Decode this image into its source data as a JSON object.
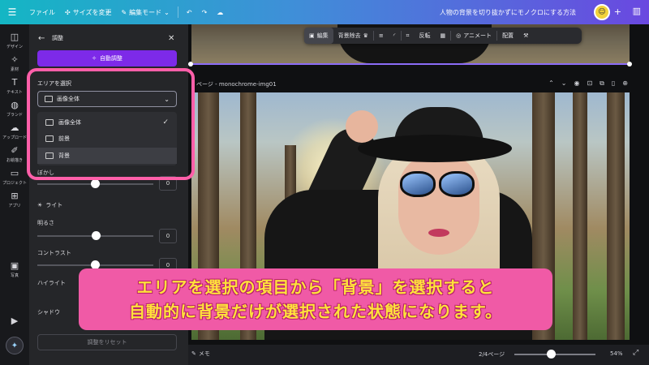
{
  "topbar": {
    "file": "ファイル",
    "resize": "サイズを変更",
    "edit_mode": "編集モード",
    "title": "人物の背景を切り抜かずにモノクロにする方法"
  },
  "rail": {
    "design": "デザイン",
    "elements": "素材",
    "text": "テキスト",
    "brand": "ブランド",
    "uploads": "アップロード",
    "drawing": "お絵描き",
    "projects": "プロジェクト",
    "apps": "アプリ",
    "photos": "写真"
  },
  "panel": {
    "title": "調整",
    "auto_adjust": "自動調整",
    "area_label": "エリアを選択",
    "area_selected": "画像全体",
    "options": [
      {
        "label": "画像全体"
      },
      {
        "label": "前景"
      },
      {
        "label": "背景"
      }
    ],
    "partial_label": "ぼかし",
    "light_header": "ライト",
    "brightness_label": "明るさ",
    "brightness_value": "0",
    "contrast_label": "コントラスト",
    "contrast_value": "0",
    "highlight_label": "ハイライト",
    "shadow_label": "シャドウ",
    "blur_value": "0",
    "reset": "調整をリセット"
  },
  "toolbar": {
    "edit": "編集",
    "bg_remove": "背景除去",
    "flip": "反転",
    "animate": "アニメート",
    "arrange": "配置"
  },
  "page": {
    "name": "ページ - monochrome-img01"
  },
  "caption": {
    "line1": "エリアを選択の項目から「背景」を選択すると",
    "line2": "自動的に背景だけが選択された状態になります。"
  },
  "bottombar": {
    "memo": "メモ",
    "page_indicator": "2/4ページ",
    "zoom": "54%"
  },
  "sliders": {
    "brightness_fraction": 0.5,
    "zoom_fraction": 0.4
  },
  "colors": {
    "accent": "#7d2ae8",
    "highlight": "#ff5fa9",
    "caption_bg": "#f05aa6",
    "caption_text": "#ffe23b"
  }
}
